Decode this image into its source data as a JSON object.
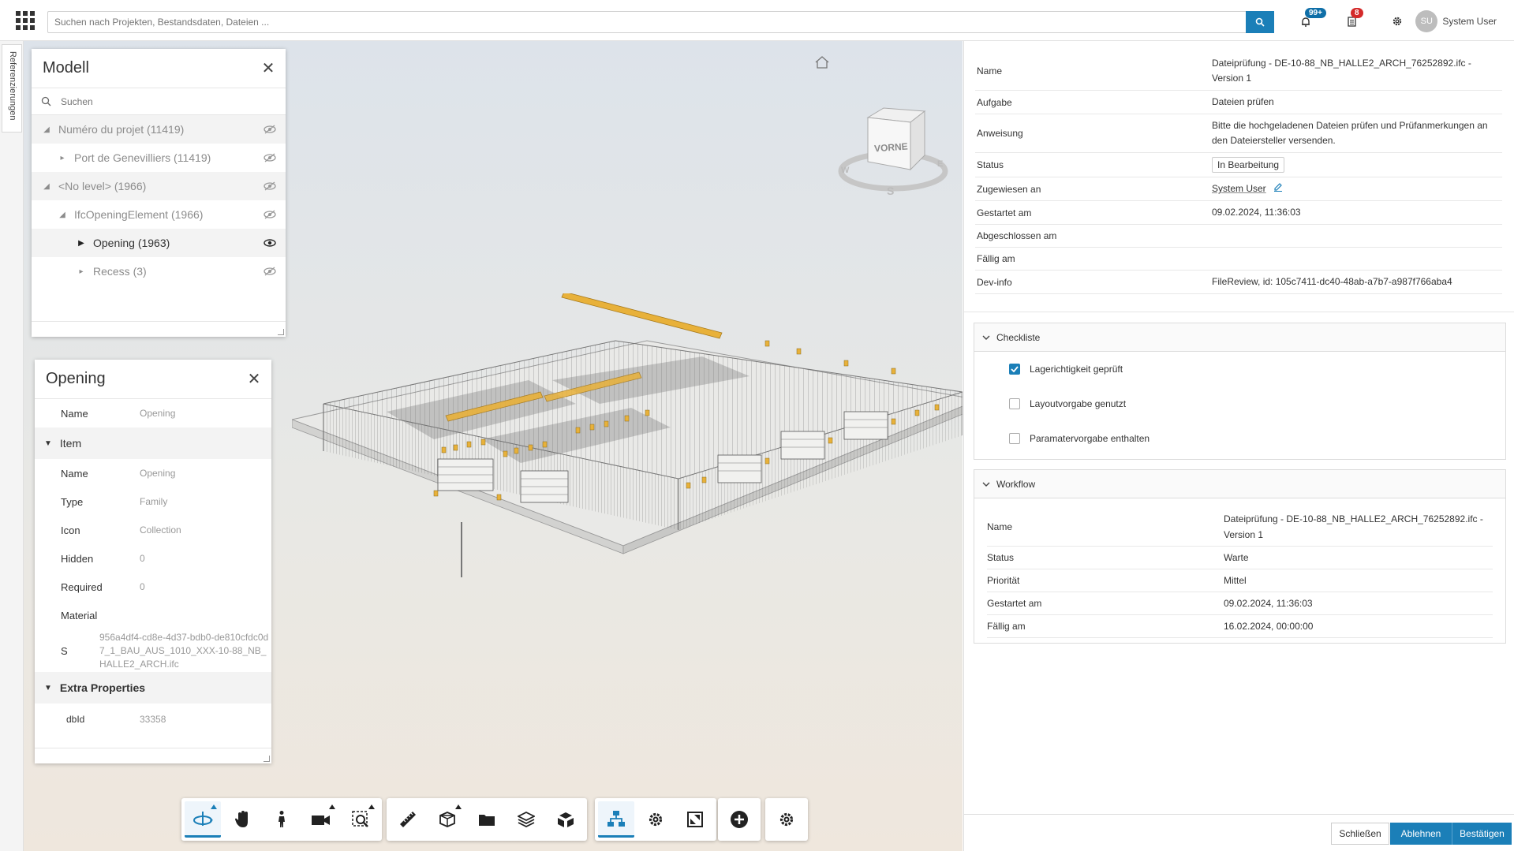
{
  "topbar": {
    "search_placeholder": "Suchen nach Projekten, Bestandsdaten, Dateien ...",
    "notifications_badge": "99+",
    "tasks_badge": "8",
    "avatar_initials": "SU",
    "username": "System User"
  },
  "rail": {
    "tab_label": "Referenzierungen"
  },
  "model_panel": {
    "title": "Modell",
    "search_placeholder": "Suchen",
    "tree": [
      {
        "label": "Numéro du projet (11419)",
        "indent": 0,
        "expanded": true,
        "visible": false
      },
      {
        "label": "Port de Genevilliers (11419)",
        "indent": 1,
        "expanded": false,
        "visible": false
      },
      {
        "label": "<No level> (1966)",
        "indent": 0,
        "expanded": true,
        "visible": false
      },
      {
        "label": "IfcOpeningElement (1966)",
        "indent": 1,
        "expanded": true,
        "visible": false
      },
      {
        "label": "Opening (1963)",
        "indent": 2,
        "expanded": false,
        "visible": true
      },
      {
        "label": "Recess (3)",
        "indent": 2,
        "expanded": false,
        "visible": false
      }
    ]
  },
  "opening_panel": {
    "title": "Opening",
    "name_key": "Name",
    "name_val": "Opening",
    "item_section": "Item",
    "item": [
      {
        "k": "Name",
        "v": "Opening"
      },
      {
        "k": "Type",
        "v": "Family"
      },
      {
        "k": "Icon",
        "v": "Collection"
      },
      {
        "k": "Hidden",
        "v": "0"
      },
      {
        "k": "Required",
        "v": "0"
      },
      {
        "k": "Material",
        "v": ""
      }
    ],
    "s_key": "S",
    "s_val": "956a4df4-cd8e-4d37-bdb0-de810cfdc0d7_1_BAU_AUS_1010_XXX-10-88_NB_HALLE2_ARCH.ifc",
    "extra_section": "Extra Properties",
    "dbid_key": "dbId",
    "dbid_val": "33358"
  },
  "viewcube": {
    "face": "VORNE",
    "compass": [
      "W",
      "E",
      "S"
    ]
  },
  "details": [
    {
      "k": "Name",
      "v": "Dateiprüfung - DE-10-88_NB_HALLE2_ARCH_76252892.ifc - Version 1"
    },
    {
      "k": "Aufgabe",
      "v": "Dateien prüfen"
    },
    {
      "k": "Anweisung",
      "v": "Bitte die hochgeladenen Dateien prüfen und Prüfanmerkungen an den Dateiersteller versenden."
    },
    {
      "k": "Status",
      "v": "In Bearbeitung"
    },
    {
      "k": "Zugewiesen an",
      "v": "System User"
    },
    {
      "k": "Gestartet am",
      "v": "09.02.2024, 11:36:03"
    },
    {
      "k": "Abgeschlossen am",
      "v": ""
    },
    {
      "k": "Fällig am",
      "v": ""
    },
    {
      "k": "Dev-info",
      "v": "FileReview, id: 105c7411-dc40-48ab-a7b7-a987f766aba4"
    }
  ],
  "checklist": {
    "title": "Checkliste",
    "items": [
      {
        "label": "Lagerichtigkeit geprüft",
        "checked": true
      },
      {
        "label": "Layoutvorgabe genutzt",
        "checked": false
      },
      {
        "label": "Paramatervorgabe enthalten",
        "checked": false
      }
    ]
  },
  "workflow": {
    "title": "Workflow",
    "rows": [
      {
        "k": "Name",
        "v": "Dateiprüfung - DE-10-88_NB_HALLE2_ARCH_76252892.ifc - Version 1"
      },
      {
        "k": "Status",
        "v": "Warte"
      },
      {
        "k": "Priorität",
        "v": "Mittel"
      },
      {
        "k": "Gestartet am",
        "v": "09.02.2024, 11:36:03"
      },
      {
        "k": "Fällig am",
        "v": "16.02.2024, 00:00:00"
      }
    ]
  },
  "footer": {
    "close": "Schließen",
    "reject": "Ablehnen",
    "confirm": "Bestätigen"
  },
  "colors": {
    "accent": "#1b7fb8",
    "highlight": "#e8b13a",
    "badge_red": "#d42a2a"
  }
}
